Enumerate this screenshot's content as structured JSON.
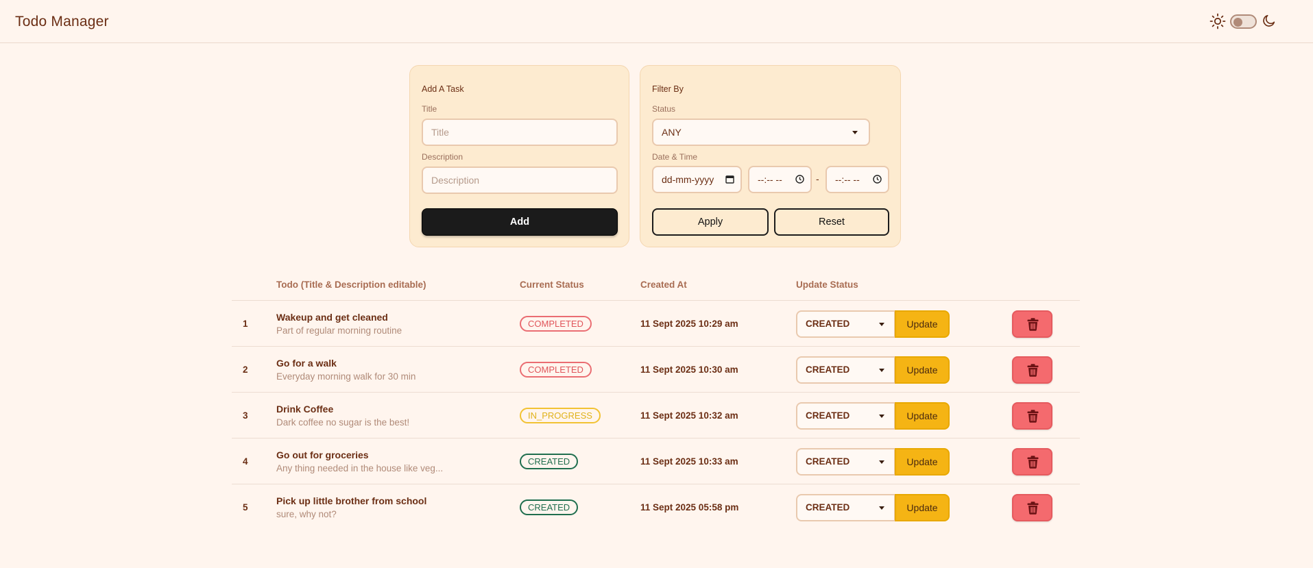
{
  "header": {
    "title": "Todo Manager",
    "icons": {
      "light": "sun-icon",
      "dark": "moon-icon"
    },
    "theme_toggle": {
      "dark_mode": false
    }
  },
  "add_task": {
    "heading": "Add A Task",
    "title_label": "Title",
    "title_placeholder": "Title",
    "title_value": "",
    "description_label": "Description",
    "description_placeholder": "Description",
    "description_value": "",
    "add_label": "Add"
  },
  "filter": {
    "heading": "Filter By",
    "status_label": "Status",
    "status_value": "ANY",
    "datetime_label": "Date & Time",
    "date_placeholder": "dd-mm-yyyy",
    "time_from_placeholder": "--:-- --",
    "time_to_placeholder": "--:-- --",
    "range_separator": "-",
    "apply_label": "Apply",
    "reset_label": "Reset"
  },
  "table": {
    "columns": {
      "todo": "Todo (Title & Description editable)",
      "current_status": "Current Status",
      "created_at": "Created At",
      "update_status": "Update Status"
    },
    "update_label": "Update",
    "rows": [
      {
        "num": "1",
        "title": "Wakeup and get cleaned",
        "description": "Part of regular morning routine",
        "status": "COMPLETED",
        "created_at": "11 Sept 2025 10:29 am",
        "update_select": "CREATED"
      },
      {
        "num": "2",
        "title": "Go for a walk",
        "description": "Everyday morning walk for 30 min",
        "status": "COMPLETED",
        "created_at": "11 Sept 2025 10:30 am",
        "update_select": "CREATED"
      },
      {
        "num": "3",
        "title": "Drink Coffee",
        "description": "Dark coffee no sugar is the best!",
        "status": "IN_PROGRESS",
        "created_at": "11 Sept 2025 10:32 am",
        "update_select": "CREATED"
      },
      {
        "num": "4",
        "title": "Go out for groceries",
        "description": "Any thing needed in the house like veg...",
        "status": "CREATED",
        "created_at": "11 Sept 2025 10:33 am",
        "update_select": "CREATED"
      },
      {
        "num": "5",
        "title": "Pick up little brother from school",
        "description": "sure, why not?",
        "status": "CREATED",
        "created_at": "11 Sept 2025 05:58 pm",
        "update_select": "CREATED"
      }
    ]
  },
  "colors": {
    "background": "#fff5ee",
    "card": "#fdebd0",
    "text": "#6b2e14",
    "completed": "#e0555a",
    "in_progress": "#e0b21a",
    "created": "#1f6e4e",
    "update_button": "#f5b414",
    "delete_button": "#f46a6e"
  }
}
